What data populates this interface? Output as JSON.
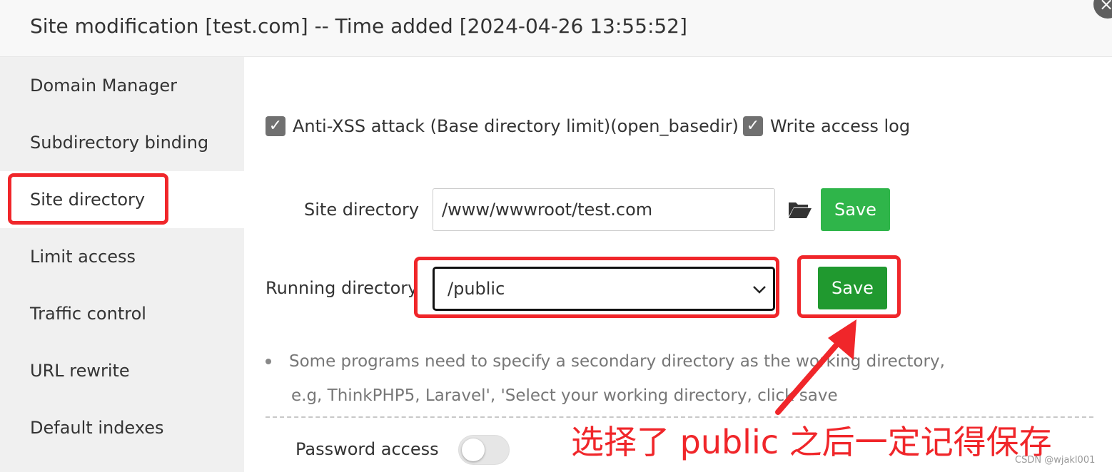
{
  "dialog": {
    "title": "Site modification [test.com] -- Time added [2024-04-26 13:55:52]",
    "close_glyph": "×"
  },
  "sidebar": {
    "items": [
      {
        "label": "Domain Manager"
      },
      {
        "label": "Subdirectory binding"
      },
      {
        "label": "Site directory",
        "active": true
      },
      {
        "label": "Limit access"
      },
      {
        "label": "Traffic control"
      },
      {
        "label": "URL rewrite"
      },
      {
        "label": "Default indexes"
      }
    ]
  },
  "options": {
    "anti_xss_label": "Anti-XSS attack (Base directory limit)(open_basedir)",
    "anti_xss_checked": true,
    "access_log_label": "Write access log",
    "access_log_checked": true
  },
  "site_dir": {
    "label": "Site directory",
    "value": "/www/wwwroot/test.com",
    "save_label": "Save"
  },
  "run_dir": {
    "label": "Running directory",
    "selected": "/public",
    "save_label": "Save"
  },
  "help": {
    "line1": "Some programs need to specify a secondary directory as the working directory,",
    "line2": "e.g, ThinkPHP5, Laravel', 'Select your working directory, click save"
  },
  "password_access": {
    "label": "Password access",
    "enabled": false
  },
  "annotation": {
    "text": "选择了 public 之后一定记得保存"
  },
  "watermark": "CSDN @wjakl001",
  "colors": {
    "save_button": "#20a53a",
    "highlight_red": "#f0262a",
    "sidebar_bg": "#f0f0f0"
  }
}
